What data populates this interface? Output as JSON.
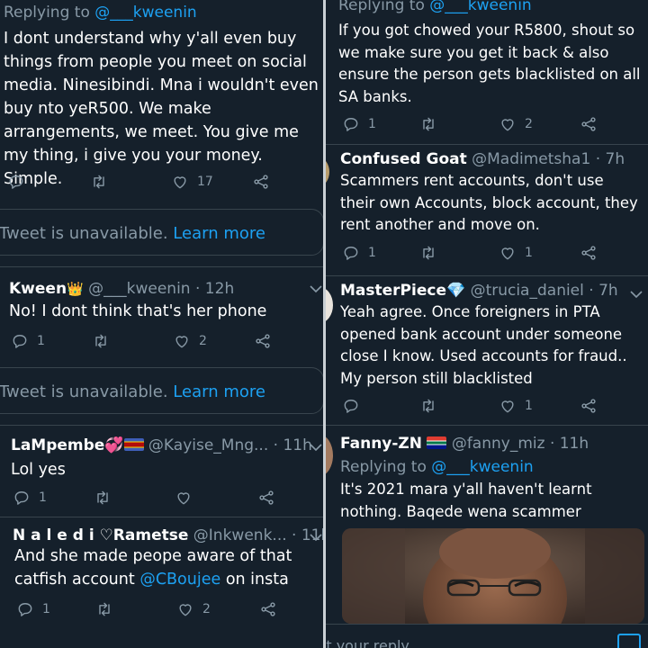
{
  "left": {
    "tweet1": {
      "reply_prefix": "Replying to",
      "reply_handle": "@___kweenin",
      "text": "I dont understand why y'all even buy things from people you meet on social media. Ninesibindi. Mna i wouldn't even buy nto yeR500. We make arrangements, we meet. You give me my thing, i give you your money. Simple.",
      "likes": "17"
    },
    "unavailable1": {
      "text": "Tweet is unavailable.",
      "link": "Learn more"
    },
    "tweet2": {
      "name": "Kween",
      "handle": "@___kweenin",
      "time": "· 12h",
      "text": "No! I dont think that's her phone",
      "replies": "1",
      "likes": "2"
    },
    "unavailable2": {
      "text": "Tweet is unavailable.",
      "link": "Learn more"
    },
    "tweet3": {
      "name": "LaMpembe",
      "handle": "@Kayise_Mng...",
      "time": "· 11h",
      "text": "Lol yes",
      "replies": "1"
    },
    "tweet4": {
      "name": "N a l e d i ♡Rametse",
      "handle": "@Inkwenk...",
      "time": "· 11h",
      "text": "And she made peope aware of that catfish account",
      "mention": "@CBoujee",
      "text_end": "on insta",
      "replies": "1",
      "likes": "2"
    }
  },
  "right": {
    "tweet1": {
      "reply_prefix": "Replying to",
      "reply_handle": "@___kweenin",
      "text": "If you got chowed your R5800, shout so we make sure you get it back & also ensure the person gets blacklisted on all SA banks.",
      "replies": "1",
      "likes": "2"
    },
    "tweet2": {
      "name": "Confused Goat",
      "handle": "@Madimetsha1",
      "time": "· 7h",
      "text": "Scammers rent accounts, don't use their own Accounts,  block account, they rent another and move on.",
      "replies": "1",
      "likes": "1"
    },
    "tweet3": {
      "name": "MasterPiece",
      "handle": "@trucia_daniel",
      "time": "· 7h",
      "text": "Yeah agree. Once foreigners in PTA opened bank account under someone close I know. Used accounts for fraud.. My person still  blacklisted",
      "likes": "1"
    },
    "tweet4": {
      "name": "Fanny-ZN",
      "handle": "@fanny_miz",
      "time": "· 11h",
      "reply_prefix": "Replying to",
      "reply_handle": "@___kweenin",
      "text": "It's 2021 mara y'all haven't learnt nothing. Baqede wena scammer"
    },
    "composer_placeholder": "st your reply"
  },
  "colors": {
    "background": "#15202b",
    "muted": "#8899a6",
    "link": "#1da1f2",
    "border": "#38444d"
  },
  "icons": [
    "reply-icon",
    "retweet-icon",
    "like-icon",
    "share-icon",
    "chevron-down-icon"
  ]
}
